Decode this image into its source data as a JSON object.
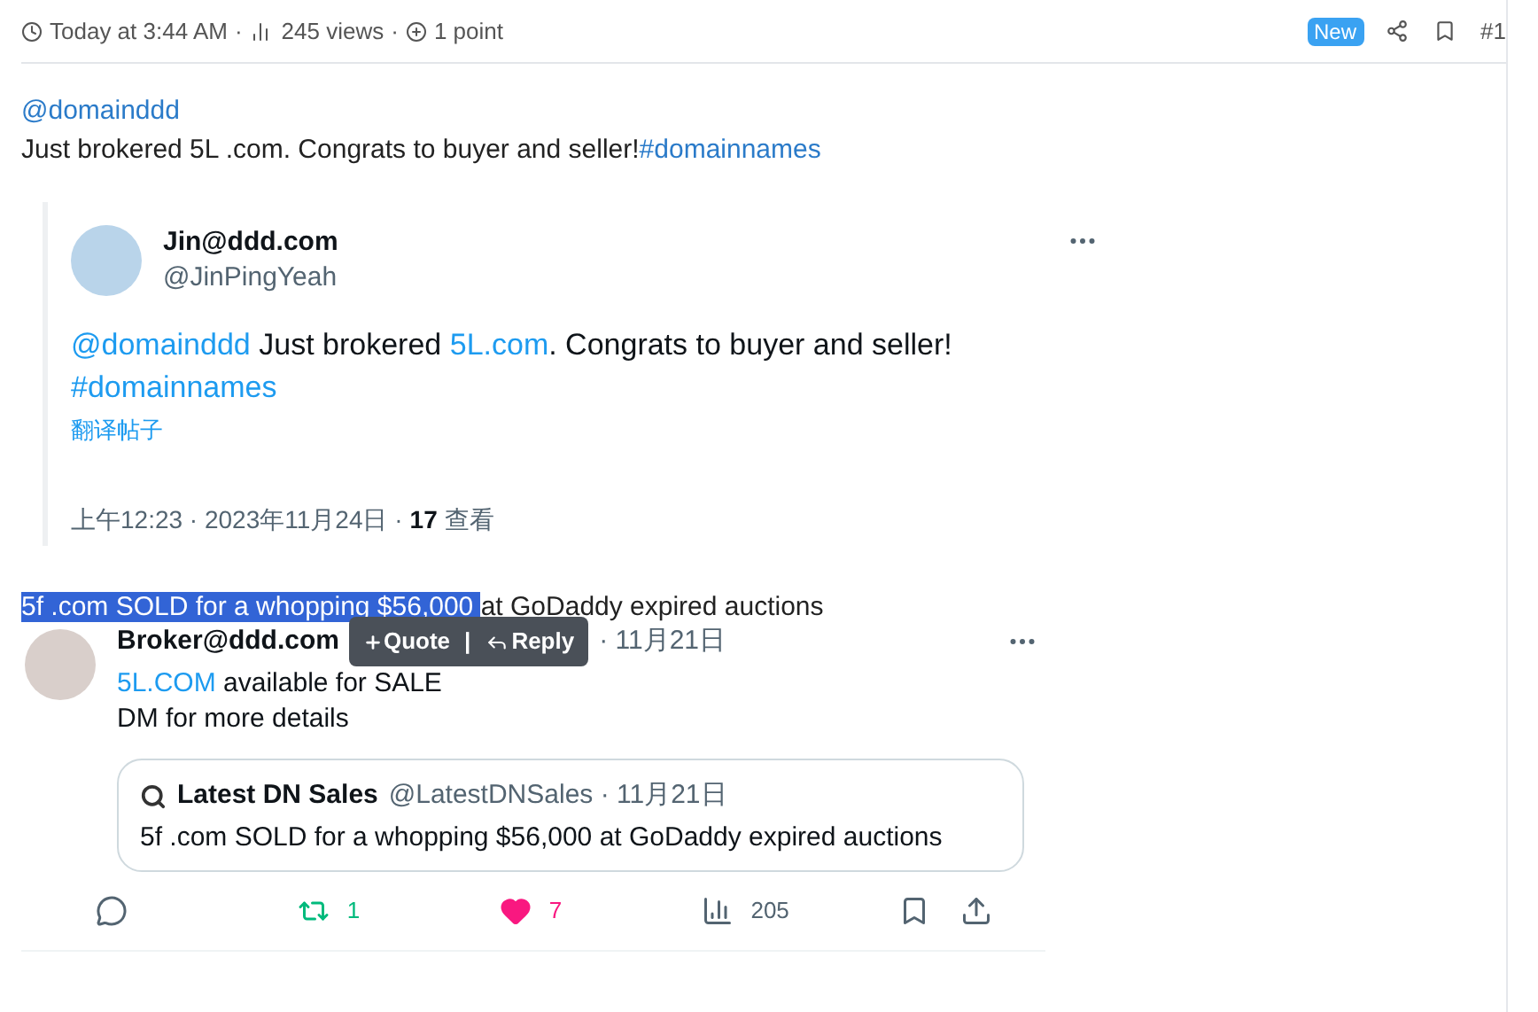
{
  "post_meta": {
    "time": "Today at 3:44 AM",
    "views": "245 views",
    "points": "1 point",
    "separator": "·",
    "badge": "New",
    "number": "#1"
  },
  "post_body": {
    "mention": "@domainddd",
    "text": "Just brokered 5L .com. Congrats to buyer and seller!",
    "hashtag": "#domainnames"
  },
  "embedded_tweet": {
    "name": "Jin@ddd.com",
    "handle": "@JinPingYeah",
    "mention": "@domainddd",
    "text_1": "Just brokered",
    "link": "5L.com",
    "text_2": ". Congrats to buyer and seller!",
    "hashtag": "#domainnames",
    "translate": "翻译帖子",
    "timestamp": "上午12:23 · 2023年11月24日 ·",
    "views_count": "17",
    "views_label": "查看"
  },
  "quote_line": {
    "selected_text": "5f .com SOLD for a whopping $56,000",
    "rest": "at GoDaddy expired auctions"
  },
  "selection_popup": {
    "quote": "Quote",
    "separator": "|",
    "reply": "Reply"
  },
  "reply_tweet": {
    "name": "Broker@ddd.com",
    "date": "· 11月21日",
    "link": "5L.COM",
    "text_1": "available for SALE",
    "text_2": "DM for more details",
    "quoted": {
      "name": "Latest DN Sales",
      "handle": "@LatestDNSales · 11月21日",
      "text": "5f .com SOLD for a whopping $56,000 at GoDaddy expired auctions"
    },
    "actions": [
      {
        "kind": "reply"
      },
      {
        "kind": "retweet",
        "count": "1"
      },
      {
        "kind": "like",
        "count": "7"
      },
      {
        "kind": "views",
        "count": "205"
      },
      {
        "kind": "bookmark"
      },
      {
        "kind": "share"
      }
    ]
  }
}
